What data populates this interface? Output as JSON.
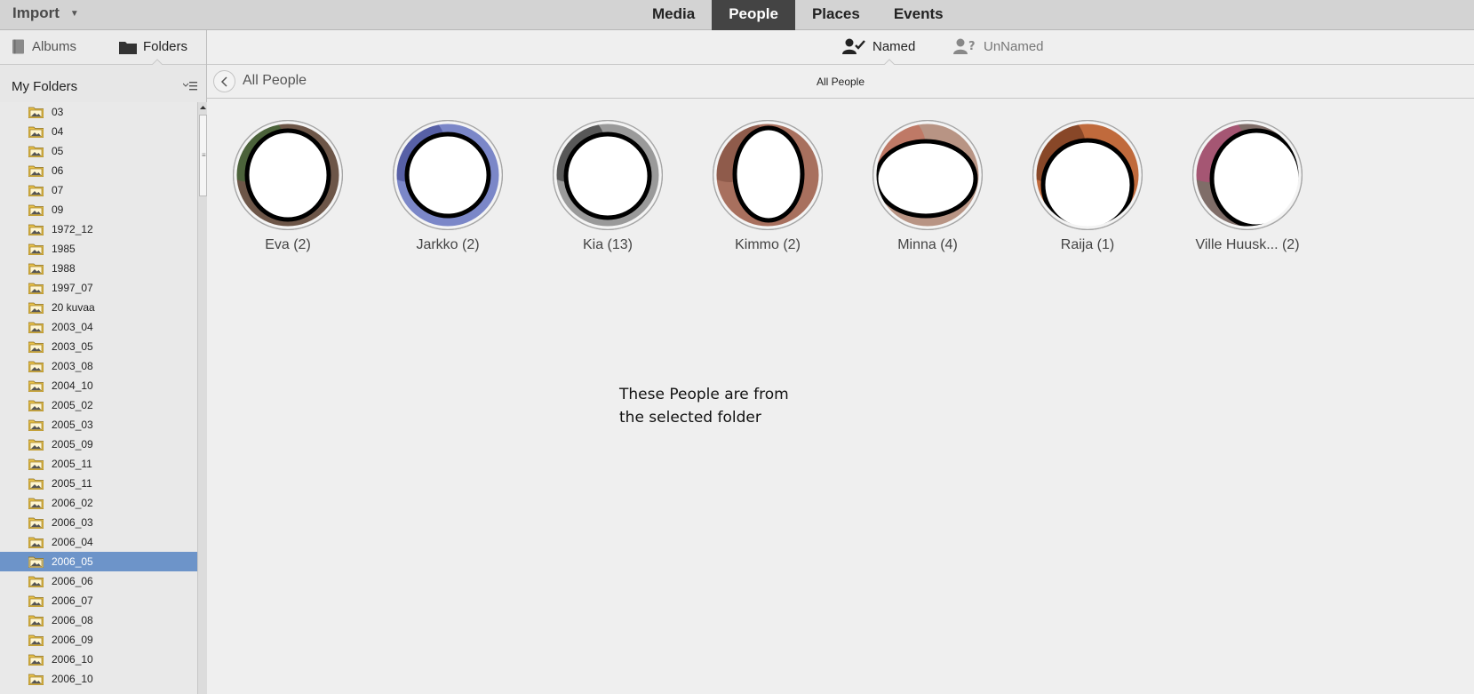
{
  "topbar": {
    "import_label": "Import",
    "tabs": [
      {
        "label": "Media",
        "active": false
      },
      {
        "label": "People",
        "active": true
      },
      {
        "label": "Places",
        "active": false
      },
      {
        "label": "Events",
        "active": false
      }
    ]
  },
  "sidebar": {
    "albums_label": "Albums",
    "folders_label": "Folders",
    "title": "My Folders",
    "folders": [
      "03",
      "04",
      "05",
      "06",
      "07",
      "09",
      "1972_12",
      "1985",
      "1988",
      "1997_07",
      "20 kuvaa",
      "2003_04",
      "2003_05",
      "2003_08",
      "2004_10",
      "2005_02",
      "2005_03",
      "2005_09",
      "2005_11",
      "2005_11",
      "2006_02",
      "2006_03",
      "2006_04",
      "2006_05",
      "2006_06",
      "2006_07",
      "2006_08",
      "2006_09",
      "2006_10",
      "2006_10"
    ],
    "selected_folder": "2006_05"
  },
  "subtabs": {
    "named_label": "Named",
    "unnamed_label": "UnNamed"
  },
  "crumb": {
    "title": "All People",
    "center_title": "All People"
  },
  "people": [
    {
      "label": "Eva (2)",
      "photo": "#6d5648",
      "rim": "#2f6e2f"
    },
    {
      "label": "Jarkko (2)",
      "photo": "#7b87c8",
      "rim": "#3b3f8a"
    },
    {
      "label": "Kia (13)",
      "photo": "#9a9a9a",
      "rim": "#222222"
    },
    {
      "label": "Kimmo (2)",
      "photo": "#a8705e",
      "rim": "#7a4a3c"
    },
    {
      "label": "Minna (4)",
      "photo": "#b89484",
      "rim": "#c4634e"
    },
    {
      "label": "Raija (1)",
      "photo": "#c06a3c",
      "rim": "#5a2a18"
    },
    {
      "label": "Ville Huusk... (2)",
      "photo": "#7f6d68",
      "rim": "#c4447c"
    }
  ],
  "note": "These People are from\nthe selected folder",
  "colors": {
    "active_tab_bg": "#444444",
    "selected_folder_bg": "#6d94c9",
    "folder_icon": "#e9c24a"
  }
}
